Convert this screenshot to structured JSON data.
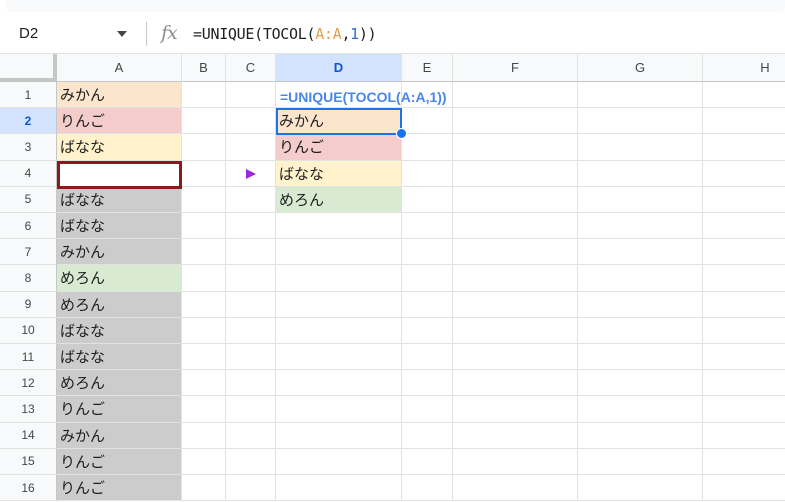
{
  "name_box": {
    "value": "D2"
  },
  "formula_bar": {
    "fx_label": "fx",
    "prefix": "=UNIQUE(TOCOL(",
    "ref": "A:A",
    "comma": ",",
    "num": "1",
    "suffix": "))"
  },
  "columns": [
    "A",
    "B",
    "C",
    "D",
    "E",
    "F",
    "G",
    "H"
  ],
  "active_column": "D",
  "rows": [
    "1",
    "2",
    "3",
    "4",
    "5",
    "6",
    "7",
    "8",
    "9",
    "10",
    "11",
    "12",
    "13",
    "14",
    "15",
    "16"
  ],
  "active_row": "2",
  "column_a": [
    {
      "text": "みかん",
      "color": "#fce5cd"
    },
    {
      "text": "りんご",
      "color": "#f4cccc"
    },
    {
      "text": "ばなな",
      "color": "#fff2cc"
    },
    {
      "text": "",
      "color": "#ffffff"
    },
    {
      "text": "ばなな",
      "color": "#cccccc"
    },
    {
      "text": "ばなな",
      "color": "#cccccc"
    },
    {
      "text": "みかん",
      "color": "#cccccc"
    },
    {
      "text": "めろん",
      "color": "#d9ead3"
    },
    {
      "text": "めろん",
      "color": "#cccccc"
    },
    {
      "text": "ばなな",
      "color": "#cccccc"
    },
    {
      "text": "ばなな",
      "color": "#cccccc"
    },
    {
      "text": "めろん",
      "color": "#cccccc"
    },
    {
      "text": "りんご",
      "color": "#cccccc"
    },
    {
      "text": "みかん",
      "color": "#cccccc"
    },
    {
      "text": "りんご",
      "color": "#cccccc"
    },
    {
      "text": "りんご",
      "color": "#cccccc"
    }
  ],
  "column_d": {
    "formula_display": "=UNIQUE(TOCOL(A:A,1))",
    "results": [
      {
        "text": "みかん",
        "color": "#fce5cd"
      },
      {
        "text": "りんご",
        "color": "#f4cccc"
      },
      {
        "text": "ばなな",
        "color": "#fff2cc"
      },
      {
        "text": "めろん",
        "color": "#d9ead3"
      }
    ]
  },
  "accent_colors": {
    "selection_blue": "#1a73e8",
    "header_active_bg": "#d3e3fd",
    "selected_cell_border": "#8b1a1a",
    "arrow_purple": "#9c27e0"
  }
}
